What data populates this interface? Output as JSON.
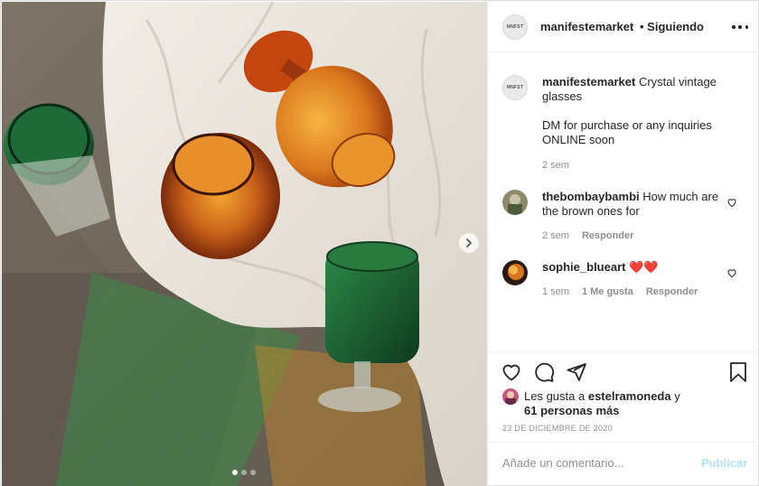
{
  "post": {
    "account": {
      "avatar_text": "MNFST",
      "username": "manifestemarket",
      "follow_status": "• Siguiendo"
    },
    "carousel": {
      "slides": 3,
      "active_index": 0
    },
    "caption": {
      "username": "manifestemarket",
      "text_line1": "Crystal vintage glasses",
      "text_line2": "DM for purchase or any inquiries ONLINE soon",
      "time": "2 sem"
    },
    "comments": [
      {
        "username": "thebombaybambi",
        "text": "How much are the brown ones for",
        "time": "2 sem",
        "reply": "Responder"
      },
      {
        "username": "sophie_blueart",
        "text": "❤️❤️",
        "time": "1 sem",
        "likes": "1 Me gusta",
        "reply": "Responder"
      }
    ],
    "likes": {
      "prefix": "Les gusta a",
      "user": "estelramoneda",
      "suffix": "y",
      "others": "61 personas más"
    },
    "date": "23 DE DICIEMBRE DE 2020",
    "add_comment": {
      "placeholder": "Añade un comentario...",
      "publish_label": "Publicar"
    },
    "icons": {
      "more": "more-horizontal-icon",
      "like": "heart-icon",
      "comment": "comment-icon",
      "share": "paper-plane-icon",
      "save": "bookmark-icon",
      "next": "chevron-right-icon"
    },
    "colors": {
      "publish_disabled": "#b2dffc",
      "secondary_text": "#8e8e8e",
      "heart_red": "#ed4956"
    }
  }
}
